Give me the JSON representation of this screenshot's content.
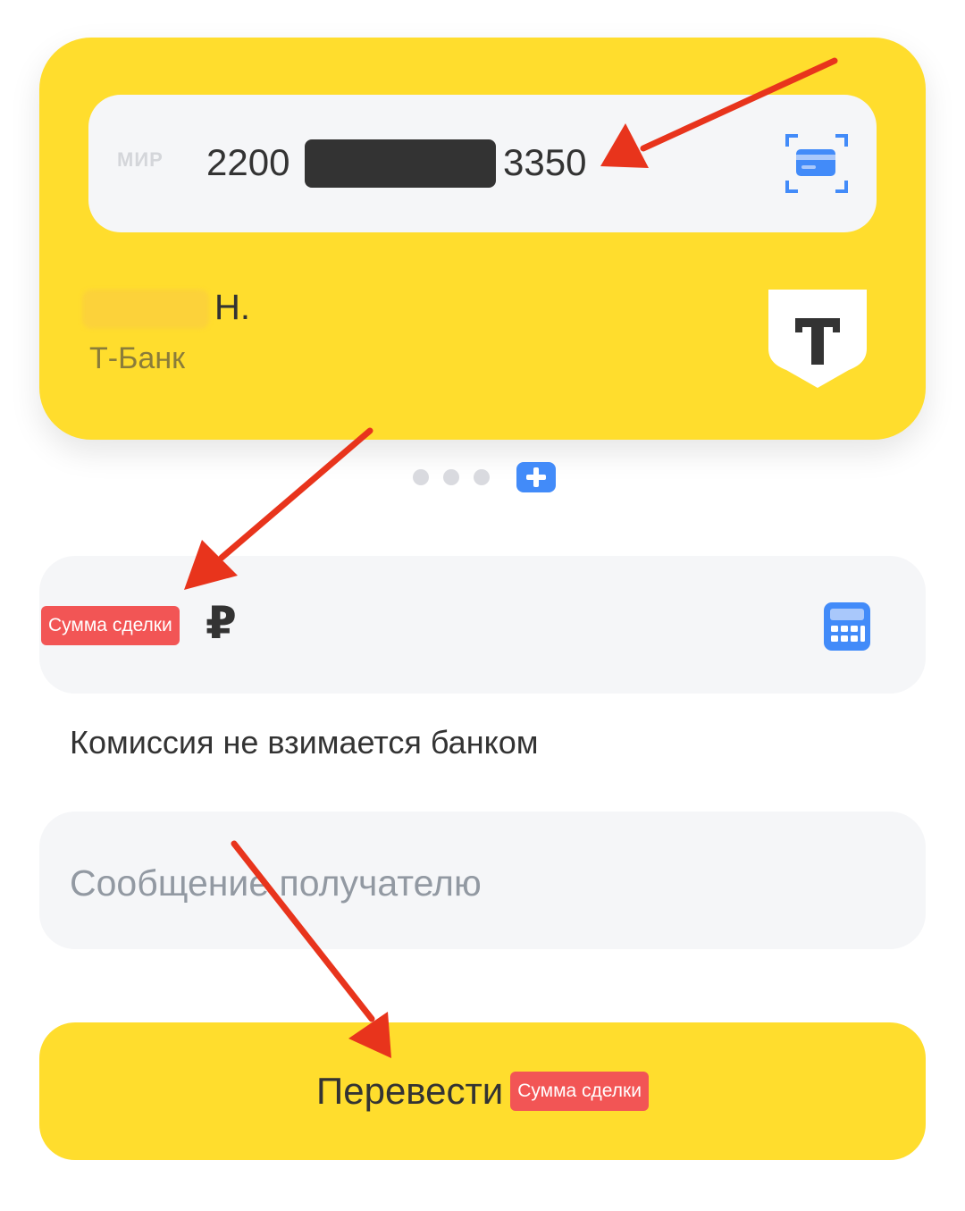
{
  "card": {
    "payment_system": "МИР",
    "number_first": "2200",
    "number_last": "3350",
    "holder_name": "Н.",
    "bank_name": "Т-Банк",
    "bank_logo_letter": "T",
    "scan_icon": "card-scan-icon"
  },
  "pagination": {
    "dot_count": 3,
    "add_icon": "plus-icon"
  },
  "amount": {
    "tag": "Сумма сделки",
    "currency_symbol": "₽",
    "calc_icon": "calculator-icon"
  },
  "commission_text": "Комиссия не взимается банком",
  "message": {
    "placeholder": "Сообщение получателю",
    "value": ""
  },
  "transfer": {
    "label": "Перевести",
    "tag": "Сумма сделки"
  },
  "colors": {
    "brand_yellow": "#ffdd2d",
    "field_bg": "#f5f6f8",
    "accent_blue": "#428bf9",
    "tag_red": "#f25555",
    "arrow_red": "#e8341c",
    "text_dark": "#333333",
    "placeholder_gray": "#9299a2"
  }
}
